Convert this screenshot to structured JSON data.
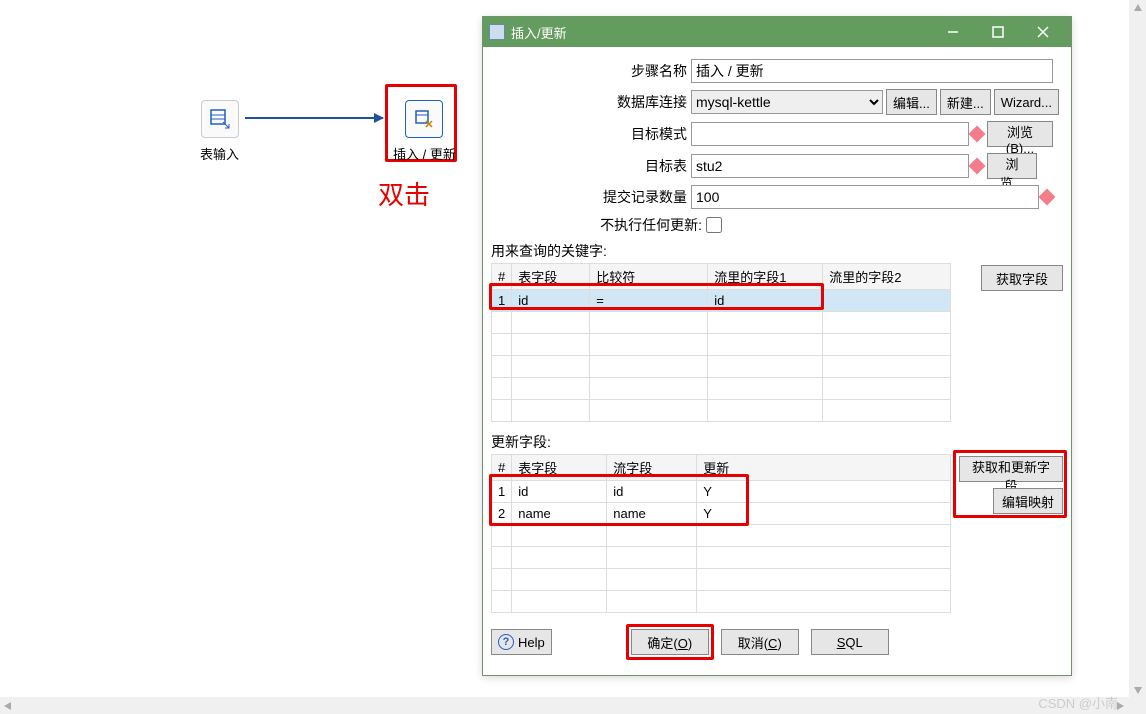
{
  "canvas": {
    "node1_label": "表输入",
    "node2_label": "插入 / 更新",
    "annotation": "双击"
  },
  "dialog": {
    "title": "插入/更新",
    "labels": {
      "step_name": "步骤名称",
      "db_conn": "数据库连接",
      "target_schema": "目标模式",
      "target_table": "目标表",
      "commit_size": "提交记录数量",
      "no_update": "不执行任何更新:"
    },
    "values": {
      "step_name": "插入 / 更新",
      "db_conn": "mysql-kettle",
      "target_schema": "",
      "target_table": "stu2",
      "commit_size": "100"
    },
    "buttons": {
      "edit": "编辑...",
      "new": "新建...",
      "wizard": "Wizard...",
      "browse_b": "浏览(B)...",
      "browse": "浏览...",
      "get_fields": "获取字段",
      "get_update_fields": "获取和更新字段",
      "edit_mapping": "编辑映射",
      "help": "Help",
      "ok": "确定(O)",
      "cancel": "取消(C)",
      "sql": "SQL"
    },
    "sections": {
      "keys": "用来查询的关键字:",
      "updates": "更新字段:"
    },
    "keys_headers": [
      "#",
      "表字段",
      "比较符",
      "流里的字段1",
      "流里的字段2"
    ],
    "keys_rows": [
      [
        "1",
        "id",
        "=",
        "id",
        ""
      ]
    ],
    "updates_headers": [
      "#",
      "表字段",
      "流字段",
      "更新"
    ],
    "updates_rows": [
      [
        "1",
        "id",
        "id",
        "Y"
      ],
      [
        "2",
        "name",
        "name",
        "Y"
      ]
    ]
  },
  "watermark": "CSDN @小南"
}
